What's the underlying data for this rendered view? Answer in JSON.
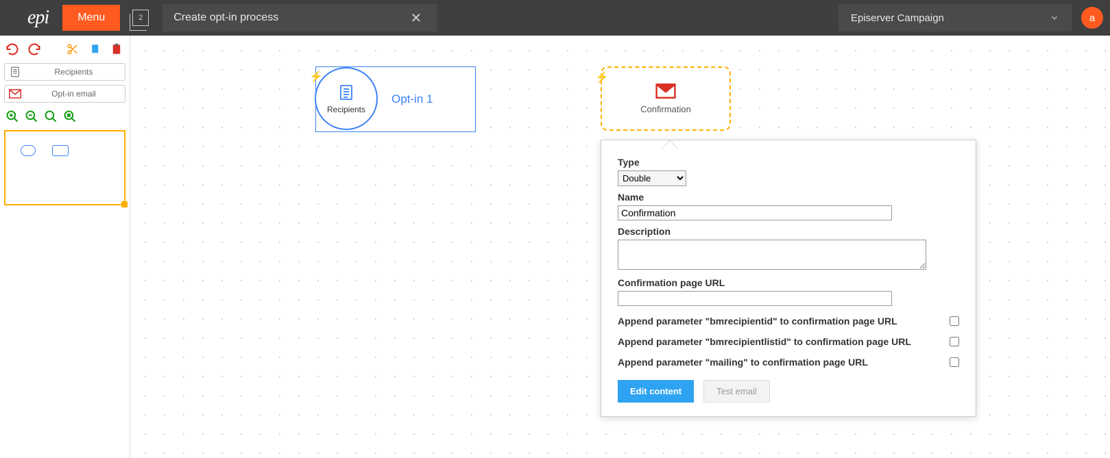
{
  "header": {
    "logo_text": "epi",
    "menu_label": "Menu",
    "doc_count": "2",
    "tab_title": "Create opt-in process",
    "product_name": "Episerver Campaign",
    "avatar_letter": "a"
  },
  "sidebar": {
    "palette": [
      {
        "label": "Recipients",
        "icon": "file"
      },
      {
        "label": "Opt-in email",
        "icon": "mail"
      }
    ]
  },
  "canvas": {
    "optin_node": {
      "circle_label": "Recipients",
      "title": "Opt-in 1"
    },
    "conf_node": {
      "title": "Confirmation"
    }
  },
  "popup": {
    "type_label": "Type",
    "type_value": "Double",
    "name_label": "Name",
    "name_value": "Confirmation",
    "desc_label": "Description",
    "desc_value": "",
    "url_label": "Confirmation page URL",
    "url_value": "",
    "chk1": "Append parameter \"bmrecipientid\" to confirmation page URL",
    "chk2": "Append parameter \"bmrecipientlistid\" to confirmation page URL",
    "chk3": "Append parameter \"mailing\" to confirmation page URL",
    "btn_edit": "Edit content",
    "btn_test": "Test email"
  }
}
